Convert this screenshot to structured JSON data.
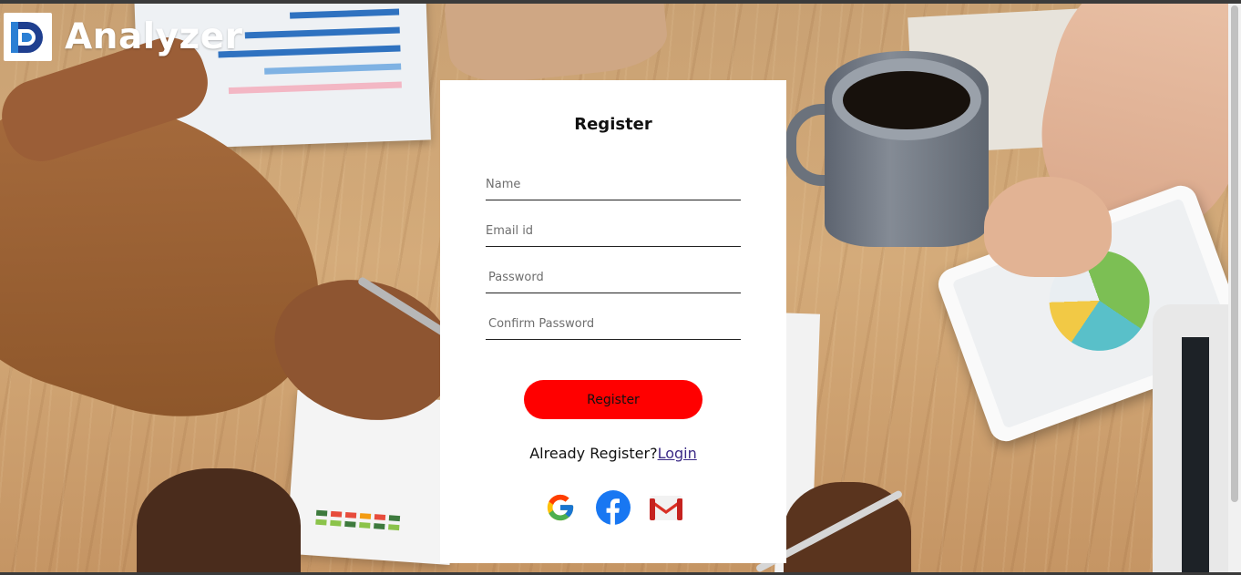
{
  "brand": {
    "name": "Analyzer",
    "logo_letter": "D",
    "logo_colors": {
      "primary": "#1f3f8f",
      "accent": "#2b7fd4"
    }
  },
  "register_form": {
    "title": "Register",
    "fields": [
      {
        "name": "name",
        "placeholder": "Name",
        "value": ""
      },
      {
        "name": "email",
        "placeholder": "Email id",
        "value": ""
      },
      {
        "name": "password",
        "placeholder": "Password",
        "value": ""
      },
      {
        "name": "confirm_password",
        "placeholder": "Confirm Password",
        "value": ""
      }
    ],
    "submit_label": "Register",
    "submit_color": "#ff0000",
    "already_text": "Already Register?",
    "login_link": "Login"
  },
  "social_logins": [
    {
      "icon": "google-icon"
    },
    {
      "icon": "facebook-icon",
      "color": "#1877f2"
    },
    {
      "icon": "gmail-icon",
      "color": "#d93025"
    }
  ]
}
